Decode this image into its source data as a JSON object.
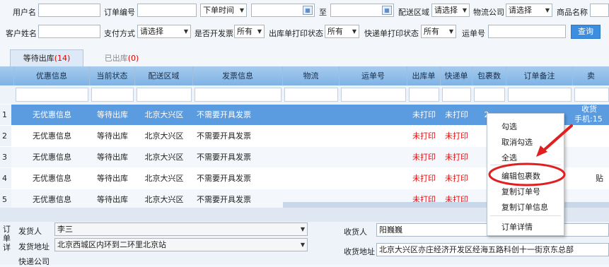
{
  "filters": {
    "row1": {
      "username_label": "用户名",
      "order_no_label": "订单编号",
      "order_time_select": "下单时间",
      "to_label": "至",
      "region_label": "配送区域",
      "region_select": "请选择",
      "logistics_label": "物流公司",
      "logistics_select": "请选择",
      "product_label": "商品名称"
    },
    "row2": {
      "customer_label": "客户姓名",
      "payment_label": "支付方式",
      "payment_select": "请选择",
      "invoice_label": "是否开发票",
      "invoice_select": "所有",
      "outbound_print_label": "出库单打印状态",
      "outbound_print_select": "所有",
      "express_print_label": "快递单打印状态",
      "express_print_select": "所有",
      "tracking_label": "运单号",
      "search_button": "查询"
    }
  },
  "tabs": [
    {
      "label": "等待出库",
      "count": "(14)"
    },
    {
      "label": "已出库",
      "count": "(0)"
    }
  ],
  "columns": [
    "优惠信息",
    "当前状态",
    "配送区域",
    "发票信息",
    "物流",
    "运单号",
    "出库单",
    "快递单",
    "包裹数",
    "订单备注",
    "卖"
  ],
  "rows": [
    {
      "num": "1",
      "discount": "无优惠信息",
      "status": "等待出库",
      "region": "北京大兴区",
      "invoice": "不需要开具发票",
      "outbound": "未打印",
      "express": "未打印",
      "packages": "2",
      "extra": "收货",
      "extra2": "手机:15"
    },
    {
      "num": "2",
      "discount": "无优惠信息",
      "status": "等待出库",
      "region": "北京大兴区",
      "invoice": "不需要开具发票",
      "outbound": "未打印",
      "express": "未打印"
    },
    {
      "num": "3",
      "discount": "无优惠信息",
      "status": "等待出库",
      "region": "北京大兴区",
      "invoice": "不需要开具发票",
      "outbound": "未打印",
      "express": "未打印"
    },
    {
      "num": "4",
      "discount": "无优惠信息",
      "status": "等待出库",
      "region": "北京大兴区",
      "invoice": "不需要开具发票",
      "outbound": "未打印",
      "express": "未打印",
      "extra": "贴"
    },
    {
      "num": "5",
      "discount": "无优惠信息",
      "status": "等待出库",
      "region": "北京大兴区",
      "invoice": "不需要开具发票",
      "outbound": "未打印",
      "express": "未打印"
    }
  ],
  "context_menu": [
    "勾选",
    "取消勾选",
    "全选",
    "编辑包裹数",
    "复制订单号",
    "复制订单信息",
    "订单详情"
  ],
  "detail": {
    "side_label": "订单详",
    "sender_label": "发货人",
    "sender_value": "李三",
    "sender_address_label": "发货地址",
    "sender_address_value": "北京西城区内环到二环里北京站",
    "logistics_label": "快递公司",
    "receiver_label": "收货人",
    "receiver_value": "阳巍巍",
    "receiver_address_label": "收货地址",
    "receiver_address_value": "北京大兴区亦庄经济开发区经海五路科创十一街京东总部"
  },
  "colors": {
    "accent": "#3d8de0",
    "selected_row": "#5b9be0",
    "annotation": "#e02020"
  }
}
